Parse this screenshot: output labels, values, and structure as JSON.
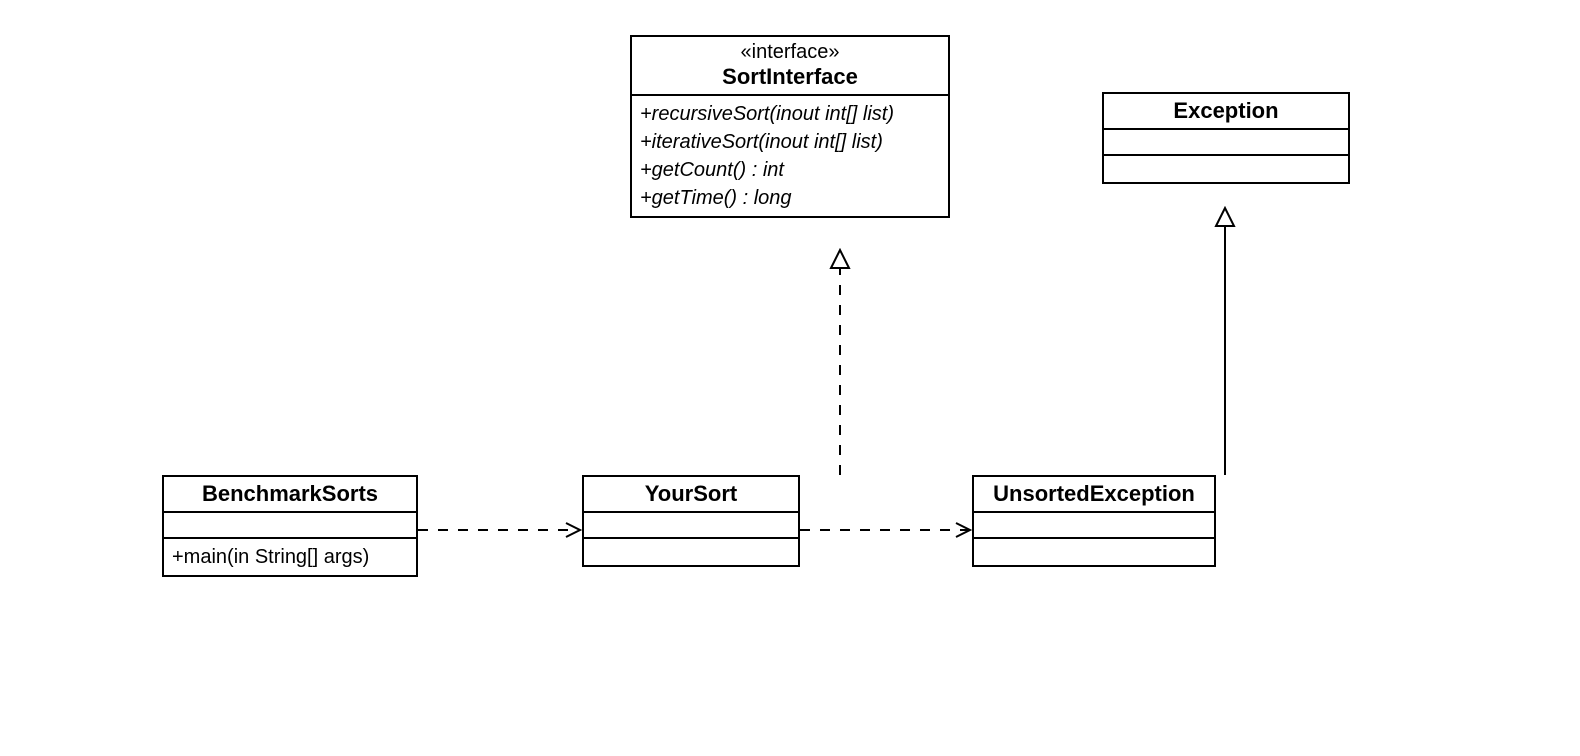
{
  "classes": {
    "sortInterface": {
      "stereotype": "«interface»",
      "name": "SortInterface",
      "methods": [
        "+recursiveSort(inout int[] list)",
        "+iterativeSort(inout int[] list)",
        "+getCount() : int",
        "+getTime() : long"
      ]
    },
    "exception": {
      "name": "Exception"
    },
    "benchmarkSorts": {
      "name": "BenchmarkSorts",
      "methods": [
        "+main(in String[] args)"
      ]
    },
    "yourSort": {
      "name": "YourSort"
    },
    "unsortedException": {
      "name": "UnsortedException"
    }
  }
}
